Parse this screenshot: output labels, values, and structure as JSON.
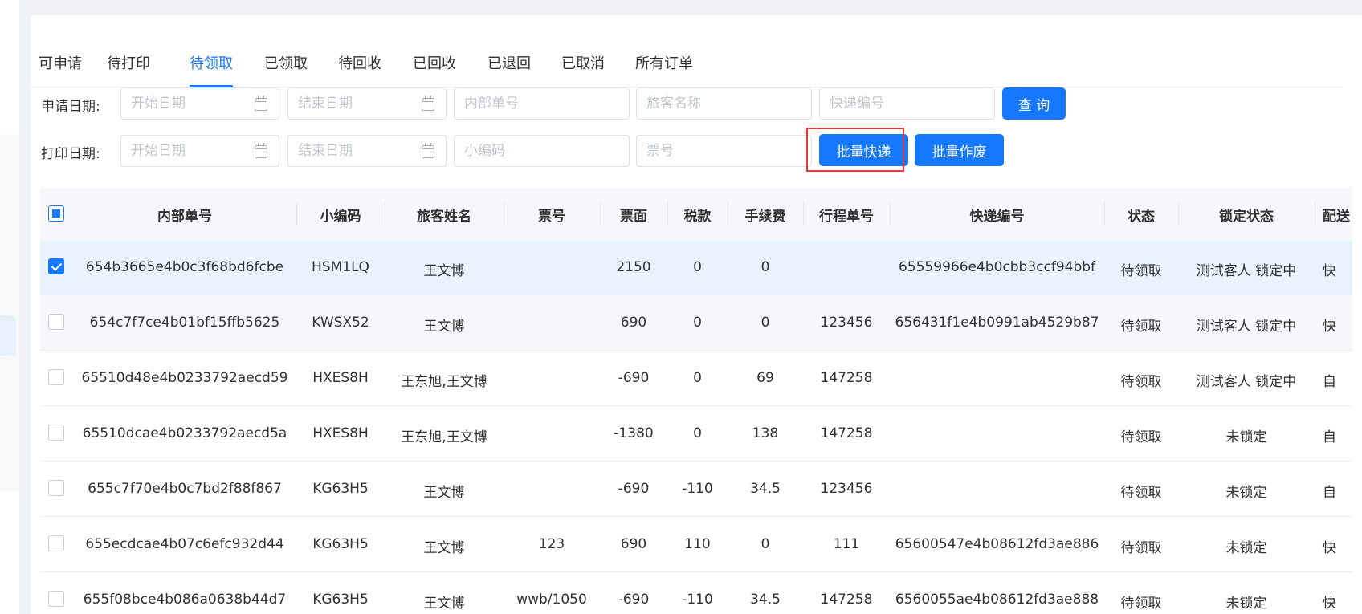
{
  "tabs": [
    {
      "label": "可申请",
      "active": false
    },
    {
      "label": "待打印",
      "active": false
    },
    {
      "label": "待领取",
      "active": true
    },
    {
      "label": "已领取",
      "active": false
    },
    {
      "label": "待回收",
      "active": false
    },
    {
      "label": "已回收",
      "active": false
    },
    {
      "label": "已退回",
      "active": false
    },
    {
      "label": "已取消",
      "active": false
    },
    {
      "label": "所有订单",
      "active": false
    }
  ],
  "filters": {
    "apply_date_label": "申请日期:",
    "print_date_label": "打印日期:",
    "start_date_placeholder": "开始日期",
    "end_date_placeholder": "结束日期",
    "internal_no_placeholder": "内部单号",
    "passenger_name_placeholder": "旅客名称",
    "express_no_placeholder": "快递编号",
    "small_code_placeholder": "小编码",
    "ticket_no_placeholder": "票号"
  },
  "buttons": {
    "query": "查 询",
    "batch_express": "批量快递",
    "batch_void": "批量作废"
  },
  "table": {
    "columns": [
      "内部单号",
      "小编码",
      "旅客姓名",
      "票号",
      "票面",
      "税款",
      "手续费",
      "行程单号",
      "快递编号",
      "状态",
      "锁定状态",
      "配送"
    ],
    "header_checkbox": "indeterminate",
    "rows": [
      {
        "checked": true,
        "cells": [
          "654b3665e4b0c3f68bd6fcbe",
          "HSM1LQ",
          "王文博",
          "",
          "2150",
          "0",
          "0",
          "",
          "65559966e4b0cbb3ccf94bbf",
          "待领取",
          "测试客人 锁定中",
          "快"
        ]
      },
      {
        "checked": false,
        "cells": [
          "654c7f7ce4b01bf15ffb5625",
          "KWSX52",
          "王文博",
          "",
          "690",
          "0",
          "0",
          "123456",
          "656431f1e4b0991ab4529b87",
          "待领取",
          "测试客人 锁定中",
          "快"
        ]
      },
      {
        "checked": false,
        "cells": [
          "65510d48e4b0233792aecd59",
          "HXES8H",
          "王东旭,王文博",
          "",
          "-690",
          "0",
          "69",
          "147258",
          "",
          "待领取",
          "测试客人 锁定中",
          "自"
        ]
      },
      {
        "checked": false,
        "cells": [
          "65510dcae4b0233792aecd5a",
          "HXES8H",
          "王东旭,王文博",
          "",
          "-1380",
          "0",
          "138",
          "147258",
          "",
          "待领取",
          "未锁定",
          "自"
        ]
      },
      {
        "checked": false,
        "cells": [
          "655c7f70e4b0c7bd2f88f867",
          "KG63H5",
          "王文博",
          "",
          "-690",
          "-110",
          "34.5",
          "123456",
          "",
          "待领取",
          "未锁定",
          "自"
        ]
      },
      {
        "checked": false,
        "cells": [
          "655ecdcae4b07c6efc932d44",
          "KG63H5",
          "王文博",
          "123",
          "690",
          "110",
          "0",
          "111",
          "65600547e4b08612fd3ae886",
          "待领取",
          "未锁定",
          "快"
        ]
      },
      {
        "checked": false,
        "cells": [
          "655f08bce4b086a0638b44d7",
          "KG63H5",
          "王文博",
          "wwb/1050",
          "-690",
          "-110",
          "34.5",
          "147258",
          "6560055ae4b08612fd3ae888",
          "待领取",
          "未锁定",
          "快"
        ]
      }
    ]
  }
}
